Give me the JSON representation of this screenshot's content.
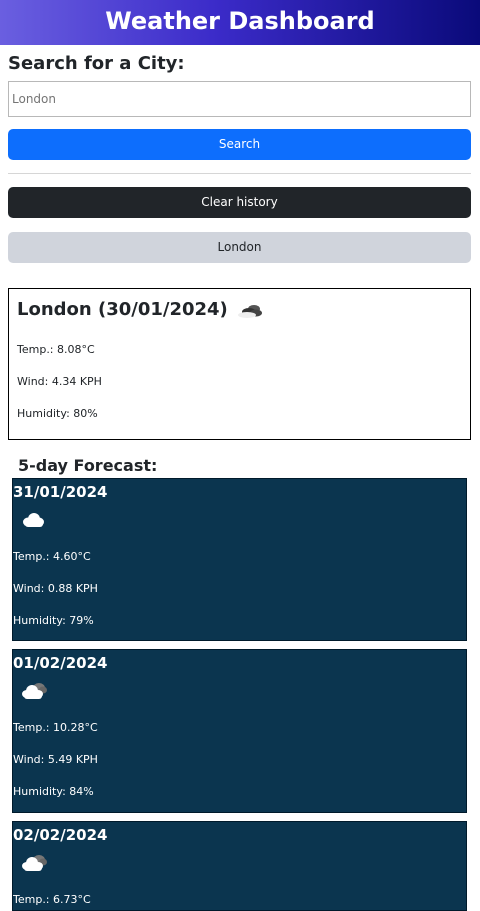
{
  "header": {
    "title": "Weather Dashboard"
  },
  "search": {
    "heading": "Search for a City:",
    "placeholder": "London",
    "button_label": "Search"
  },
  "history": {
    "clear_label": "Clear history",
    "items": [
      {
        "label": "London"
      }
    ]
  },
  "current": {
    "title": "London (30/01/2024)",
    "icon": "broken-clouds-icon",
    "temp": "Temp.: 8.08°C",
    "wind": "Wind: 4.34 KPH",
    "humidity": "Humidity: 80%"
  },
  "forecast": {
    "heading": "5-day Forecast:",
    "days": [
      {
        "date": "31/01/2024",
        "icon": "cloud-icon",
        "temp": "Temp.: 4.60°C",
        "wind": "Wind: 0.88 KPH",
        "humidity": "Humidity: 79%"
      },
      {
        "date": "01/02/2024",
        "icon": "broken-clouds-icon",
        "temp": "Temp.: 10.28°C",
        "wind": "Wind: 5.49 KPH",
        "humidity": "Humidity: 84%"
      },
      {
        "date": "02/02/2024",
        "icon": "broken-clouds-icon",
        "temp": "Temp.: 6.73°C",
        "wind": "",
        "humidity": ""
      }
    ]
  },
  "colors": {
    "header_gradient_start": "#6a5fe0",
    "header_gradient_end": "#0a0a7a",
    "search_button": "#0d6efd",
    "clear_button": "#212529",
    "history_button": "#d0d4dc",
    "forecast_card": "#0b354f"
  }
}
